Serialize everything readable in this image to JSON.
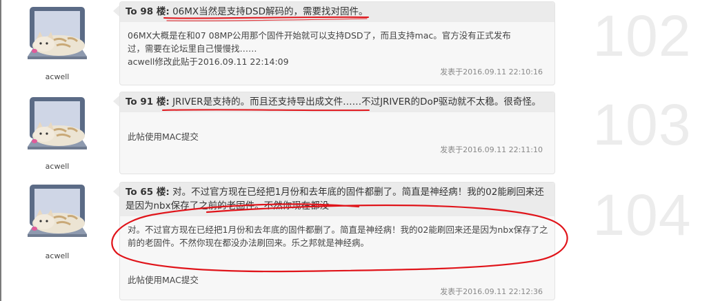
{
  "posts": [
    {
      "username": "acwell",
      "floor": "102",
      "reply_to": "To 98 楼:",
      "reply_quote": "06MX当然是支持DSD解码的，需要找对固件。",
      "body": "06MX大概是在和07 08MP公用那个固件开始就可以支持DSD了，而且支持mac。官方没有正式发布过，需要在论坛里自己慢慢找……\nacwell修改此贴于2016.09.11 22:14:09",
      "timestamp": "发表于2016.09.11 22:10:16"
    },
    {
      "username": "acwell",
      "floor": "103",
      "reply_to": "To 91 楼:",
      "reply_quote": "JRIVER是支持的。而且还支持导出成文件……不过JRIVER的DoP驱动就不太稳。很奇怪。",
      "body": "此帖使用MAC提交",
      "timestamp": "发表于2016.09.11 22:11:10"
    },
    {
      "username": "acwell",
      "floor": "104",
      "reply_to": "To 65 楼:",
      "reply_quote": "对。不过官方现在已经把1月份和去年底的固件都删了。简直是神经病！我的02能刷回来还是因为nbx保存了之前的老固件。不然你现在都没",
      "body": "对。不过官方现在已经把1月份和去年底的固件都删了。简直是神经病！我的02能刷回来还是因为nbx保存了之前的老固件。不然你现在都没办法刷回来。乐之邦就是神经病。",
      "mac_note": "此帖使用MAC提交",
      "timestamp": "发表于2016.09.11 22:12:36"
    }
  ],
  "colors": {
    "annotation": "#e0141a",
    "bubble_bg": "#f7f7f7",
    "header_bg": "#ebebeb",
    "floor_number": "#ececec"
  },
  "icons": {
    "avatar": "laptop-cat-avatar-icon"
  }
}
